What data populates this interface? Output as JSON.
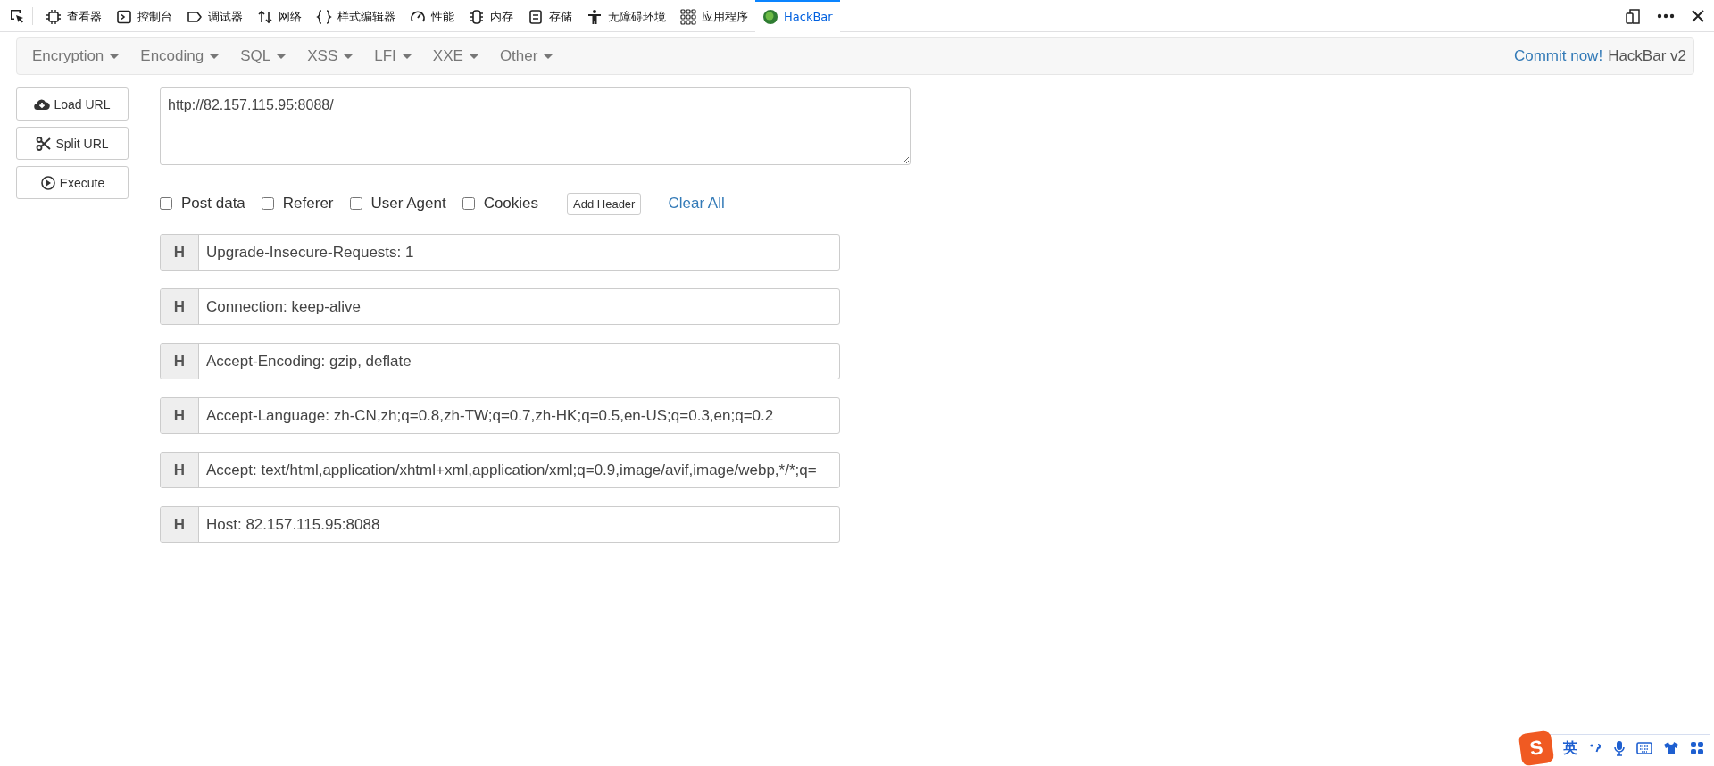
{
  "devtools": {
    "tabs": [
      {
        "label": "查看器",
        "selected": false
      },
      {
        "label": "控制台",
        "selected": false
      },
      {
        "label": "调试器",
        "selected": false
      },
      {
        "label": "网络",
        "selected": false
      },
      {
        "label": "样式编辑器",
        "selected": false
      },
      {
        "label": "性能",
        "selected": false
      },
      {
        "label": "内存",
        "selected": false
      },
      {
        "label": "存储",
        "selected": false
      },
      {
        "label": "无障碍环境",
        "selected": false
      },
      {
        "label": "应用程序",
        "selected": false
      },
      {
        "label": "HackBar",
        "selected": true
      }
    ]
  },
  "hackbar": {
    "menu": [
      {
        "label": "Encryption"
      },
      {
        "label": "Encoding"
      },
      {
        "label": "SQL"
      },
      {
        "label": "XSS"
      },
      {
        "label": "LFI"
      },
      {
        "label": "XXE"
      },
      {
        "label": "Other"
      }
    ],
    "commit_link": "Commit now!",
    "brand": "HackBar v2",
    "actions": [
      {
        "label": "Load URL"
      },
      {
        "label": "Split URL"
      },
      {
        "label": "Execute"
      }
    ],
    "url": "http://82.157.115.95:8088/",
    "options": [
      {
        "label": "Post data",
        "checked": false
      },
      {
        "label": "Referer",
        "checked": false
      },
      {
        "label": "User Agent",
        "checked": false
      },
      {
        "label": "Cookies",
        "checked": false
      }
    ],
    "add_header": "Add Header",
    "clear_all": "Clear All",
    "headers": [
      {
        "prefix": "H",
        "value": "Upgrade-Insecure-Requests: 1"
      },
      {
        "prefix": "H",
        "value": "Connection: keep-alive"
      },
      {
        "prefix": "H",
        "value": "Accept-Encoding: gzip, deflate"
      },
      {
        "prefix": "H",
        "value": "Accept-Language: zh-CN,zh;q=0.8,zh-TW;q=0.7,zh-HK;q=0.5,en-US;q=0.3,en;q=0.2"
      },
      {
        "prefix": "H",
        "value": "Accept: text/html,application/xhtml+xml,application/xml;q=0.9,image/avif,image/webp,*/*;q="
      },
      {
        "prefix": "H",
        "value": "Host: 82.157.115.95:8088"
      }
    ]
  },
  "ime": {
    "logo": "S",
    "mode": "英"
  }
}
